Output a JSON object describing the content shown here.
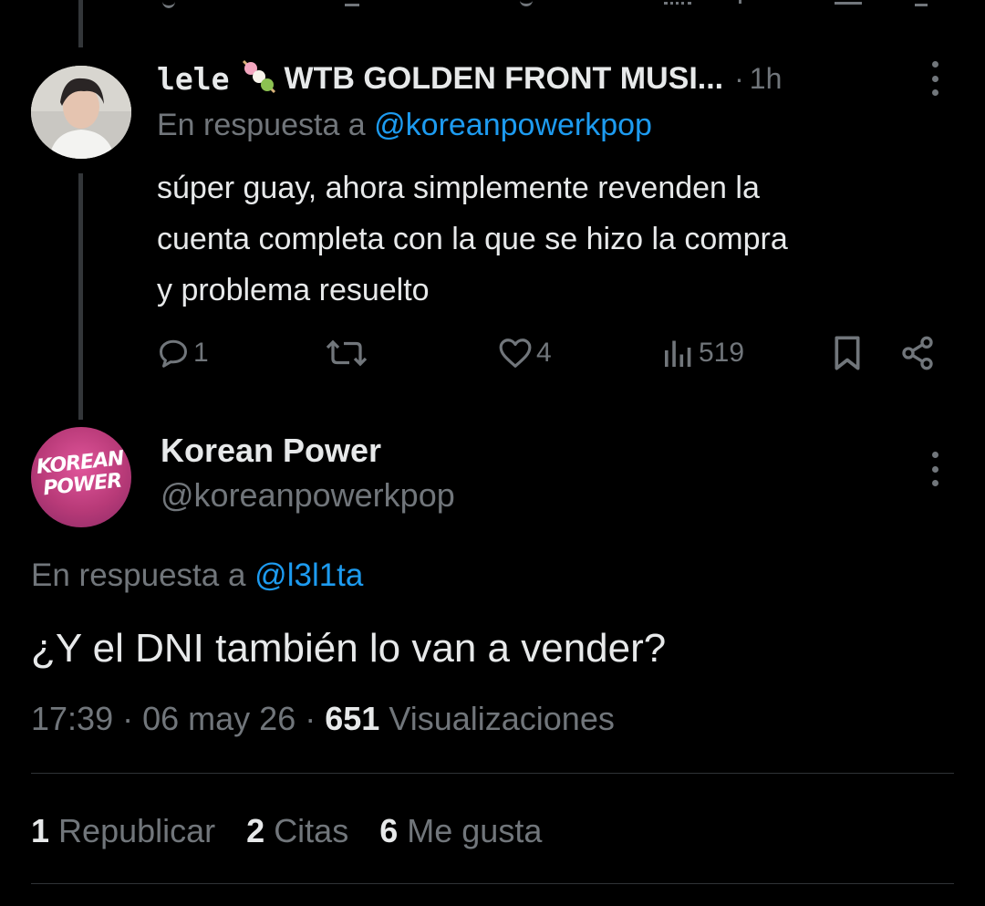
{
  "reply_tweet": {
    "user_name": "lele",
    "display_title": "WTB GOLDEN FRONT MUSI...",
    "separator": "·",
    "time_ago": "1h",
    "reply_prefix": "En respuesta a",
    "reply_to": "@koreanpowerkpop",
    "text_lines": [
      "súper guay, ahora simplemente revenden la",
      "cuenta completa con la que se hizo la compra",
      "y problema resuelto"
    ],
    "reply_count": "1",
    "like_count": "4",
    "view_count": "519"
  },
  "main_tweet": {
    "display_name": "Korean Power",
    "handle": "@koreanpowerkpop",
    "avatar_text_line1": "KOREAN",
    "avatar_text_line2": "POWER",
    "reply_prefix": "En respuesta a",
    "reply_to": "@l3l1ta",
    "text": "¿Y el DNI también lo van a vender?",
    "time": "17:39",
    "date": "06 may 26",
    "separator": "·",
    "views_count": "651",
    "views_label": "Visualizaciones"
  },
  "stats": [
    {
      "count": "1",
      "label": "Republicar"
    },
    {
      "count": "2",
      "label": "Citas"
    },
    {
      "count": "6",
      "label": "Me gusta"
    }
  ],
  "colors": {
    "background": "#000000",
    "text": "#e7e9ea",
    "muted": "#71767b",
    "link": "#1d9bf0",
    "divider": "#2f3336",
    "avatar_brand": "#c2407a"
  }
}
